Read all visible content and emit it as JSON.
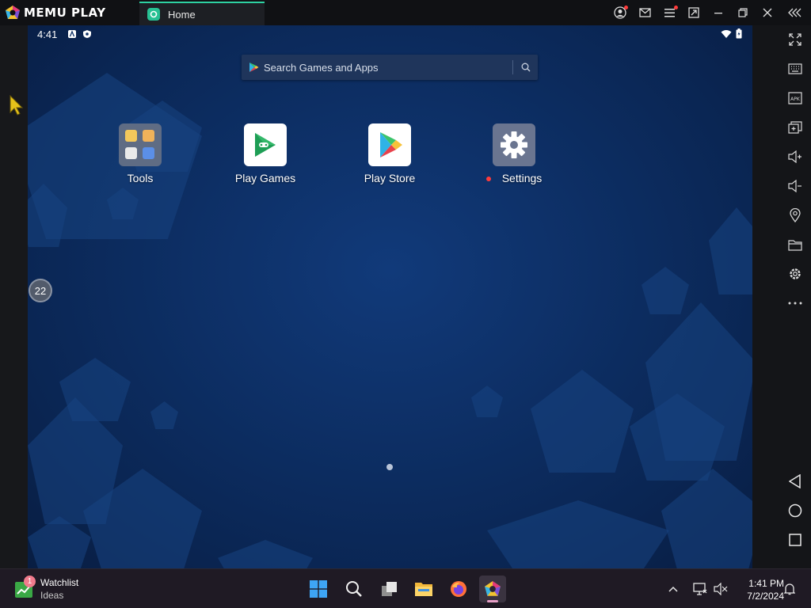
{
  "titlebar": {
    "logo_text": "MEMU PLAY",
    "tab_label": "Home"
  },
  "android": {
    "status_time": "4:41",
    "search_placeholder": "Search Games and Apps",
    "apps": [
      {
        "label": "Tools",
        "icon": "folder-icon"
      },
      {
        "label": "Play Games",
        "icon": "play-games-icon"
      },
      {
        "label": "Play Store",
        "icon": "play-store-icon"
      },
      {
        "label": "Settings",
        "icon": "gear-icon"
      }
    ],
    "cpu_usage": "22"
  },
  "sidebar_icons": [
    "fullscreen-icon",
    "keyboard-icon",
    "apk-icon",
    "multi-instance-icon",
    "volume-up-icon",
    "volume-down-icon",
    "location-icon",
    "folder-icon",
    "settings-icon",
    "more-icon",
    "back-icon",
    "home-icon",
    "recents-icon"
  ],
  "taskbar": {
    "watchlist_badge": "1",
    "watchlist_title": "Watchlist",
    "watchlist_sub": "Ideas",
    "time": "1:41 PM",
    "date": "7/2/2024"
  },
  "colors": {
    "accent": "#2ed1a2",
    "notification_red": "#ff3b3b",
    "screen_bg": "#0d2f65"
  }
}
